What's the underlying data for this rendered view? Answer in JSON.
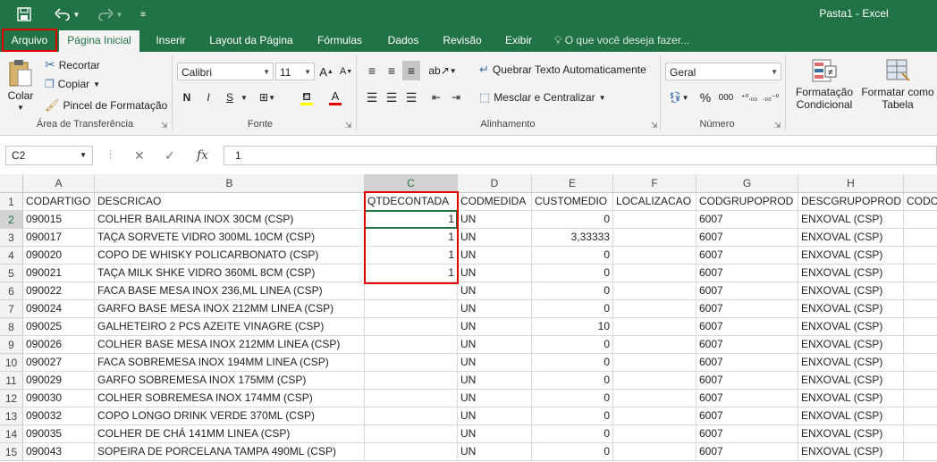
{
  "window": {
    "title": "Pasta1 - Excel"
  },
  "quick_access": {
    "save_icon": "save-icon",
    "undo_icon": "undo-icon",
    "redo_icon": "redo-icon",
    "customize_icon": "customize-icon"
  },
  "tabs": [
    "Arquivo",
    "Página Inicial",
    "Inserir",
    "Layout da Página",
    "Fórmulas",
    "Dados",
    "Revisão",
    "Exibir"
  ],
  "tell_me": "O que você deseja fazer...",
  "ribbon": {
    "clipboard": {
      "paste": "Colar",
      "cut": "Recortar",
      "copy": "Copiar",
      "format_painter": "Pincel de Formatação",
      "label": "Área de Transferência"
    },
    "font": {
      "name": "Calibri",
      "size": "11",
      "bold": "N",
      "italic": "I",
      "underline": "S",
      "label": "Fonte"
    },
    "alignment": {
      "wrap": "Quebrar Texto Automaticamente",
      "merge": "Mesclar e Centralizar",
      "label": "Alinhamento"
    },
    "number": {
      "format": "Geral",
      "label": "Número"
    },
    "styles": {
      "conditional": "Formatação Condicional",
      "table": "Formatar como Tabela"
    }
  },
  "formula_bar": {
    "name_box": "C2",
    "fx": "fx",
    "value": "1"
  },
  "columns": [
    "A",
    "B",
    "C",
    "D",
    "E",
    "F",
    "G",
    "H"
  ],
  "rows": [
    [
      "1",
      "CODARTIGO",
      "DESCRICAO",
      "QTDECONTADA",
      "CODMEDIDA",
      "CUSTOMEDIO",
      "LOCALIZACAO",
      "CODGRUPOPROD",
      "DESCGRUPOPROD",
      "CODCO"
    ],
    [
      "2",
      "090015",
      "COLHER BAILARINA INOX 30CM (CSP)",
      "1",
      "UN",
      "0",
      "",
      "6007",
      "ENXOVAL (CSP)",
      ""
    ],
    [
      "3",
      "090017",
      "TAÇA SORVETE VIDRO 300ML 10CM (CSP)",
      "1",
      "UN",
      "3,33333",
      "",
      "6007",
      "ENXOVAL (CSP)",
      ""
    ],
    [
      "4",
      "090020",
      "COPO DE WHISKY POLICARBONATO (CSP)",
      "1",
      "UN",
      "0",
      "",
      "6007",
      "ENXOVAL (CSP)",
      ""
    ],
    [
      "5",
      "090021",
      "TAÇA MILK SHKE VIDRO 360ML 8CM (CSP)",
      "1",
      "UN",
      "0",
      "",
      "6007",
      "ENXOVAL (CSP)",
      ""
    ],
    [
      "6",
      "090022",
      "FACA BASE MESA INOX 236,ML LINEA (CSP)",
      "",
      "UN",
      "0",
      "",
      "6007",
      "ENXOVAL (CSP)",
      ""
    ],
    [
      "7",
      "090024",
      "GARFO BASE MESA INOX 212MM LINEA (CSP)",
      "",
      "UN",
      "0",
      "",
      "6007",
      "ENXOVAL (CSP)",
      ""
    ],
    [
      "8",
      "090025",
      "GALHETEIRO 2 PCS AZEITE VINAGRE (CSP)",
      "",
      "UN",
      "10",
      "",
      "6007",
      "ENXOVAL (CSP)",
      ""
    ],
    [
      "9",
      "090026",
      "COLHER BASE MESA INOX 212MM LINEA (CSP)",
      "",
      "UN",
      "0",
      "",
      "6007",
      "ENXOVAL (CSP)",
      ""
    ],
    [
      "10",
      "090027",
      "FACA SOBREMESA INOX 194MM LINEA (CSP)",
      "",
      "UN",
      "0",
      "",
      "6007",
      "ENXOVAL (CSP)",
      ""
    ],
    [
      "11",
      "090029",
      "GARFO SOBREMESA INOX 175MM (CSP)",
      "",
      "UN",
      "0",
      "",
      "6007",
      "ENXOVAL (CSP)",
      ""
    ],
    [
      "12",
      "090030",
      "COLHER SOBREMESA INOX 174MM (CSP)",
      "",
      "UN",
      "0",
      "",
      "6007",
      "ENXOVAL (CSP)",
      ""
    ],
    [
      "13",
      "090032",
      "COPO LONGO DRINK VERDE 370ML (CSP)",
      "",
      "UN",
      "0",
      "",
      "6007",
      "ENXOVAL (CSP)",
      ""
    ],
    [
      "14",
      "090035",
      "COLHER DE CHÁ 141MM LINEA (CSP)",
      "",
      "UN",
      "0",
      "",
      "6007",
      "ENXOVAL (CSP)",
      ""
    ],
    [
      "15",
      "090043",
      "SOPEIRA DE PORCELANA TAMPA 490ML (CSP)",
      "",
      "UN",
      "0",
      "",
      "6007",
      "ENXOVAL (CSP)",
      ""
    ]
  ],
  "colors": {
    "excel_green": "#217346",
    "highlight_red": "#e00000"
  }
}
